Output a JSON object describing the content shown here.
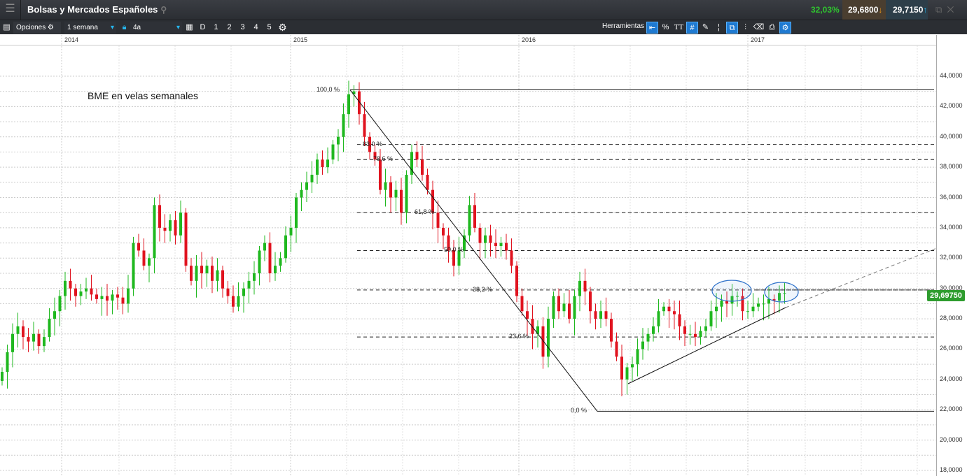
{
  "header": {
    "title": "Bolsas y Mercados Españoles",
    "change_pct": "32,03%",
    "bid": "29,6800",
    "ask": "29,7150"
  },
  "toolbar": {
    "options_label": "Opciones",
    "interval": "1 semana",
    "range": "4a",
    "day_btn": "D",
    "num_btns": [
      "1",
      "2",
      "3",
      "4",
      "5"
    ],
    "tools_label": "Herramientas",
    "pct_btn": "%",
    "text_btn": "TT"
  },
  "colors": {
    "up": "#1fb81f",
    "down": "#e0131f",
    "accent": "#1f7ad1"
  },
  "chart_data": {
    "type": "candlestick",
    "title": "BME en velas semanales",
    "x_ticks": [
      "2014",
      "2015",
      "2016",
      "2017"
    ],
    "y_ticks": [
      "44,0000",
      "42,0000",
      "40,0000",
      "38,0000",
      "36,0000",
      "34,0000",
      "32,0000",
      "30,0000",
      "28,0000",
      "26,0000",
      "24,0000",
      "22,0000",
      "20,0000",
      "18,0000"
    ],
    "ylim": [
      18000,
      44000
    ],
    "last_price": "29,69750",
    "weekly_closes_thousands": [
      24.5,
      25.8,
      27.0,
      27.5,
      26.8,
      26.5,
      27.0,
      26.2,
      26.8,
      28.0,
      28.5,
      29.5,
      30.5,
      30.0,
      29.5,
      29.8,
      30.0,
      29.6,
      29.3,
      29.5,
      29.2,
      29.6,
      29.4,
      29.0,
      30.0,
      33.0,
      32.5,
      31.5,
      32.0,
      35.5,
      34.0,
      33.8,
      34.5,
      33.5,
      35.0,
      31.5,
      30.5,
      31.5,
      31.0,
      31.5,
      30.5,
      31.2,
      30.0,
      29.5,
      28.8,
      29.5,
      30.0,
      30.5,
      31.0,
      32.5,
      33.0,
      31.0,
      31.5,
      32.0,
      33.5,
      34.0,
      36.0,
      36.5,
      37.0,
      37.5,
      38.5,
      38.0,
      38.5,
      39.5,
      40.0,
      41.5,
      42.8,
      43.0,
      41.5,
      40.0,
      39.0,
      38.5,
      36.5,
      37.0,
      36.0,
      36.5,
      35.0,
      37.5,
      39.0,
      38.5,
      37.5,
      36.5,
      35.0,
      34.0,
      33.5,
      32.5,
      31.5,
      32.5,
      33.5,
      35.5,
      34.0,
      33.0,
      33.5,
      33.0,
      32.8,
      33.0,
      32.5,
      31.5,
      29.5,
      28.5,
      28.0,
      27.0,
      27.5,
      25.5,
      28.0,
      29.5,
      28.5,
      29.0,
      28.0,
      29.5,
      30.5,
      29.8,
      28.5,
      28.0,
      28.5,
      28.0,
      26.5,
      25.5,
      24.0,
      24.8,
      25.0,
      26.0,
      26.5,
      27.0,
      27.5,
      28.5,
      28.8,
      28.5,
      28.3,
      27.5,
      27.0,
      27.0,
      26.8,
      27.2,
      27.5,
      28.5,
      28.8,
      29.2,
      29.0,
      29.5,
      29.5,
      28.5,
      28.5,
      28.8,
      29.0,
      29.0,
      29.3,
      29.2,
      29.7,
      29.7
    ],
    "fibonacci": [
      {
        "label": "100,0 %",
        "price": 43.1,
        "style": "solid"
      },
      {
        "label": "83,0 %",
        "price": 39.5,
        "style": "dashed"
      },
      {
        "label": "78,6 %",
        "price": 38.5,
        "style": "dashed"
      },
      {
        "label": "61,8 %",
        "price": 35.0,
        "style": "dashed"
      },
      {
        "label": "50,0 %",
        "price": 32.5,
        "style": "dashed"
      },
      {
        "label": "38,2 %",
        "price": 29.9,
        "style": "dashed"
      },
      {
        "label": "23,6 %",
        "price": 26.8,
        "style": "dashed"
      },
      {
        "label": "0,0 %",
        "price": 21.9,
        "style": "solid"
      }
    ]
  }
}
